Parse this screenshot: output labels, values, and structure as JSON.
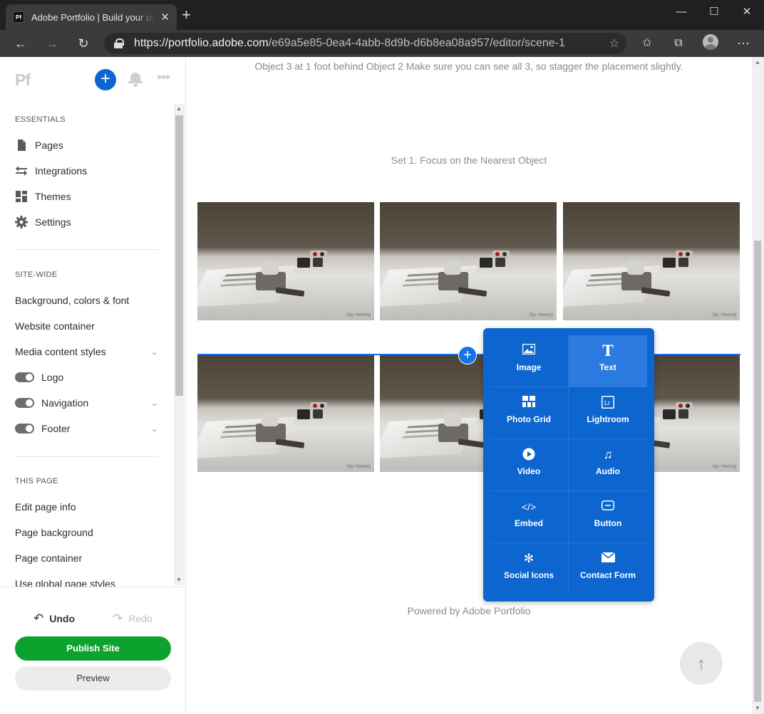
{
  "browser": {
    "tab_title": "Adobe Portfolio | Build your own personalized website",
    "tab_favicon": "Pf",
    "url_host": "https://portfolio.adobe.com",
    "url_path": "/e69a5e85-0ea4-4abb-8d9b-d6b8ea08a957/editor/scene-1"
  },
  "sidebar": {
    "logo": "Pf",
    "essentials_label": "ESSENTIALS",
    "essentials": [
      {
        "label": "Pages",
        "icon": "page-icon"
      },
      {
        "label": "Integrations",
        "icon": "integrations-icon"
      },
      {
        "label": "Themes",
        "icon": "themes-icon"
      },
      {
        "label": "Settings",
        "icon": "gear-icon"
      }
    ],
    "sitewide_label": "SITE-WIDE",
    "sitewide": [
      {
        "label": "Background, colors & font"
      },
      {
        "label": "Website container"
      },
      {
        "label": "Media content styles"
      },
      {
        "label": "Logo",
        "toggle": true
      },
      {
        "label": "Navigation",
        "toggle": true
      },
      {
        "label": "Footer",
        "toggle": true
      }
    ],
    "thispage_label": "THIS PAGE",
    "thispage": [
      {
        "label": "Edit page info"
      },
      {
        "label": "Page background"
      },
      {
        "label": "Page container"
      },
      {
        "label": "Use global page styles"
      }
    ],
    "undo_label": "Undo",
    "redo_label": "Redo",
    "publish_label": "Publish Site",
    "preview_label": "Preview"
  },
  "main": {
    "intro_text": "Object 3 at 1 foot behind Object 2 Make sure you can see all 3, so stagger the placement slightly.",
    "set_title": "Set 1. Focus on the Nearest Object",
    "photo_credit": "Jay Hwang",
    "powered_by": "Powered by Adobe Portfolio"
  },
  "insert_menu": {
    "items": [
      {
        "label": "Image",
        "icon": "image-icon"
      },
      {
        "label": "Text",
        "icon": "text-icon"
      },
      {
        "label": "Photo Grid",
        "icon": "photo-grid-icon"
      },
      {
        "label": "Lightroom",
        "icon": "lightroom-icon"
      },
      {
        "label": "Video",
        "icon": "video-icon"
      },
      {
        "label": "Audio",
        "icon": "audio-icon"
      },
      {
        "label": "Embed",
        "icon": "embed-icon"
      },
      {
        "label": "Button",
        "icon": "button-icon"
      },
      {
        "label": "Social Icons",
        "icon": "social-icons-icon"
      },
      {
        "label": "Contact Form",
        "icon": "contact-form-icon"
      }
    ],
    "highlighted": "Text"
  },
  "colors": {
    "accent_blue": "#0d66d0",
    "publish_green": "#0da22e"
  }
}
